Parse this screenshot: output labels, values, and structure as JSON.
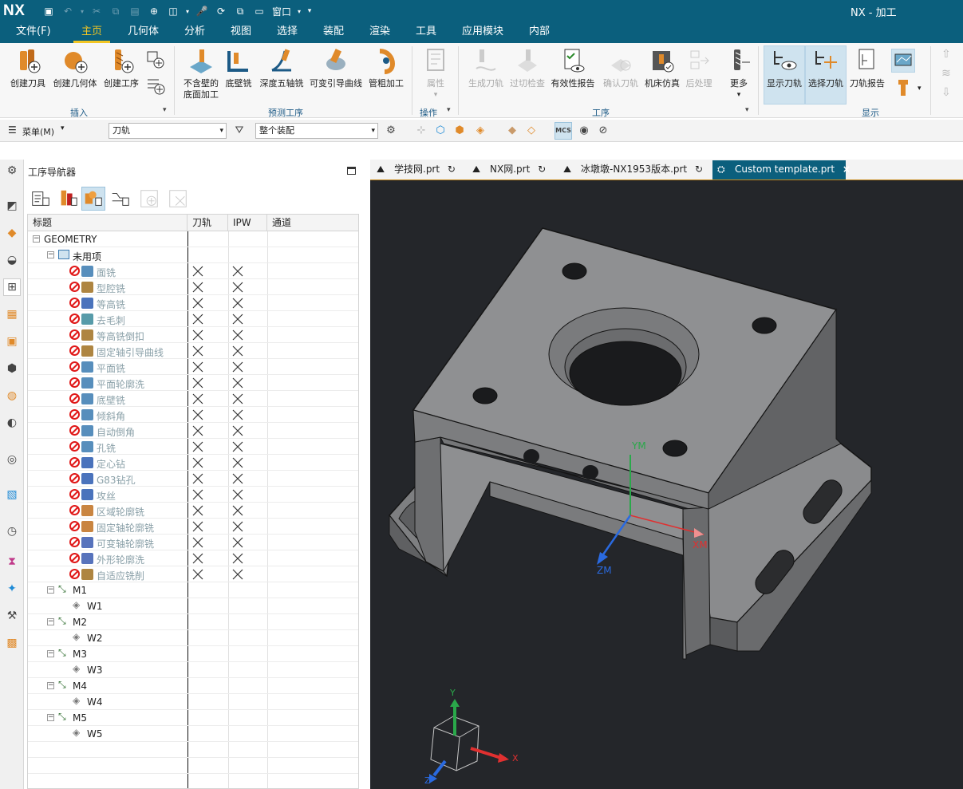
{
  "titlebar": {
    "logo": "NX",
    "window_title": "NX - 加工",
    "window_menu": "窗口"
  },
  "menubar": [
    "文件(F)",
    "主页",
    "几何体",
    "分析",
    "视图",
    "选择",
    "装配",
    "渲染",
    "工具",
    "应用模块",
    "内部"
  ],
  "ribbon": {
    "buttons": [
      "创建刀具",
      "创建几何体",
      "创建工序",
      "不含壁的\n底面加工",
      "底壁铣",
      "深度五轴铣",
      "可变引导曲线",
      "管粗加工",
      "属性",
      "生成刀轨",
      "过切检查",
      "有效性报告",
      "确认刀轨",
      "机床仿真",
      "后处理",
      "更多",
      "显示刀轨",
      "选择刀轨",
      "刀轨报告"
    ],
    "groups": [
      "插入",
      "预测工序",
      "操作",
      "工序",
      "显示"
    ]
  },
  "selection_bar": {
    "menu": "菜单(M)",
    "filter": "刀轨",
    "scope": "整个装配"
  },
  "navigator": {
    "title": "工序导航器",
    "columns": [
      "标题",
      "刀轨",
      "IPW",
      "通道"
    ],
    "root": "GEOMETRY",
    "unused": "未用项",
    "operations": [
      "面铣",
      "型腔铣",
      "等高铣",
      "去毛刺",
      "等高铣倒扣",
      "固定轴引导曲线",
      "平面铣",
      "平面轮廓洗",
      "底壁铣",
      "倾斜角",
      "自动倒角",
      "孔铣",
      "定心钻",
      "G83钻孔",
      "攻丝",
      "区域轮廓铣",
      "固定轴轮廓铣",
      "可变轴轮廓铣",
      "外形轮廓洗",
      "自适应铣削"
    ],
    "mcs": [
      {
        "name": "M1",
        "workpiece": "W1"
      },
      {
        "name": "M2",
        "workpiece": "W2"
      },
      {
        "name": "M3",
        "workpiece": "W3"
      },
      {
        "name": "M4",
        "workpiece": "W4"
      },
      {
        "name": "M5",
        "workpiece": "W5"
      }
    ]
  },
  "tabs": [
    "学技网.prt",
    "NX网.prt",
    "冰墩墩-NX1953版本.prt",
    "Custom template.prt"
  ],
  "viewport": {
    "axes": {
      "ym": "YM",
      "xm": "XM",
      "zm": "ZM"
    },
    "triad": {
      "y": "Y",
      "x": "X",
      "z": "Z"
    }
  },
  "colors": {
    "brand": "#0b5f7d",
    "accent": "#f3c623",
    "viewport_bg": "#24262a"
  }
}
